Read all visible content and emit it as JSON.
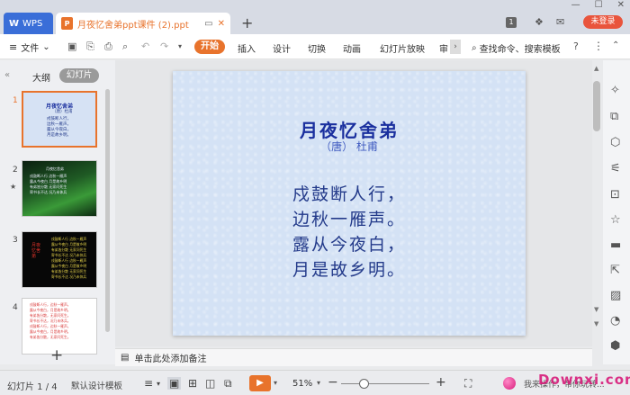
{
  "titlebar": {
    "app_name": "WPS",
    "doc_tab_label": "月夜忆舍弟ppt课件 (2).ppt",
    "doc_type_glyph": "P",
    "badge": "1",
    "login_label": "未登录",
    "window_controls": [
      "—",
      "☐",
      "✕"
    ]
  },
  "ribbon": {
    "menu_label": "文件",
    "start_tab": "开始",
    "tabs": [
      "插入",
      "设计",
      "切换",
      "动画",
      "幻灯片放映",
      "审"
    ],
    "search_label": "查找命令、搜索模板"
  },
  "leftpanel": {
    "outline_tab": "大纲",
    "slides_tab": "幻灯片",
    "slide_numbers": [
      "1",
      "2",
      "3",
      "4"
    ],
    "thumb1": {
      "title": "月夜忆舍弟",
      "lines": [
        "（唐）杜甫",
        "戍鼓断人行，",
        "边秋一雁声。",
        "露从今夜白，",
        "月是故乡明。"
      ]
    },
    "thumb2": {
      "lines": [
        "月夜忆舍弟",
        "戍鼓断人行 边秋一雁声",
        "露从今夜白 月是故乡明",
        "有弟皆分散 无家问死生",
        "寄书长不达 况乃未休兵"
      ]
    },
    "thumb3": {
      "title": "月夜忆舍弟",
      "lines": [
        "戍鼓断人行 边秋一雁声",
        "露从今夜白 月是故乡明",
        "有弟皆分散 无家问死生",
        "寄书长不达 况乃未休兵",
        "戍鼓断人行 边秋一雁声",
        "露从今夜白 月是故乡明",
        "有弟皆分散 无家问死生",
        "寄书长不达 况乃未休兵"
      ]
    },
    "thumb4": {
      "lines": [
        "戍鼓断人行，边秋一雁声。",
        "露从今夜白，月是故乡明。",
        "有弟皆分散，无家问死生。",
        "寄书长不达，况乃未休兵。",
        "戍鼓断人行，边秋一雁声。",
        "露从今夜白，月是故乡明。",
        "有弟皆分散，无家问死生。"
      ]
    }
  },
  "slide": {
    "title": "月夜忆舍弟",
    "author": "（唐） 杜甫",
    "lines": [
      "戍鼓断人行，",
      "边秋一雁声。",
      "露从今夜白，",
      "月是故乡明。"
    ]
  },
  "notes": {
    "placeholder": "单击此处添加备注"
  },
  "status": {
    "slide_counter": "幻灯片 1 / 4",
    "template": "默认设计模板",
    "zoom": "51%",
    "zoom_level_percent": 51
  },
  "watermark": {
    "domain": "Downxi.com",
    "text": "我来操作，带你玩转..."
  }
}
